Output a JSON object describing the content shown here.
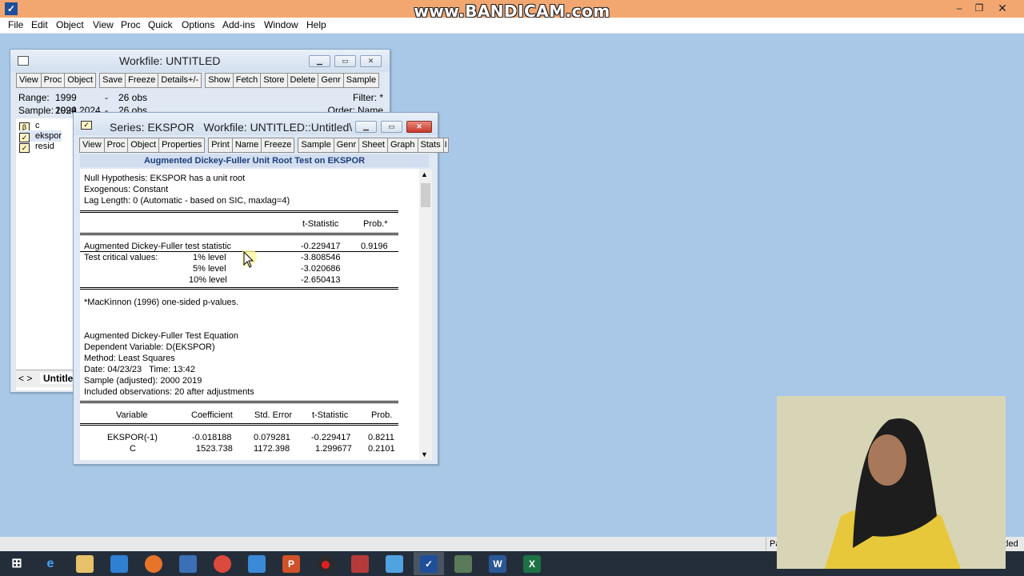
{
  "watermark": "www.BANDICAM.com",
  "menu": [
    "File",
    "Edit",
    "Object",
    "View",
    "Proc",
    "Quick",
    "Options",
    "Add-ins",
    "Window",
    "Help"
  ],
  "workfile": {
    "title": "Workfile: UNTITLED",
    "toolbar": [
      "View",
      "Proc",
      "Object",
      "Save",
      "Freeze",
      "Details+/-",
      "Show",
      "Fetch",
      "Store",
      "Delete",
      "Genr",
      "Sample"
    ],
    "range_label": "Range:",
    "range_value": "1999 2024",
    "range_sep": "--",
    "range_obs": "26 obs",
    "sample_label": "Sample:",
    "sample_value": "1999 2024",
    "sample_sep": "--",
    "sample_obs": "26 obs",
    "filter": "Filter: *",
    "order": "Order: Name",
    "objects": [
      {
        "icon": "β",
        "name": "c"
      },
      {
        "icon": "✓",
        "name": "ekspor"
      },
      {
        "icon": "✓",
        "name": "resid"
      }
    ],
    "tab": "Untitled",
    "tab_nav": "< >"
  },
  "series": {
    "title": "Series: EKSPOR   Workfile: UNTITLED::Untitled\\",
    "toolbar": [
      "View",
      "Proc",
      "Object",
      "Properties",
      "Print",
      "Name",
      "Freeze",
      "Sample",
      "Genr",
      "Sheet",
      "Graph",
      "Stats",
      "I"
    ],
    "subtitle": "Augmented Dickey-Fuller Unit Root Test on EKSPOR",
    "null_hypothesis": "Null Hypothesis: EKSPOR has a unit root",
    "exogenous": "Exogenous: Constant",
    "lag_length": "Lag Length: 0 (Automatic - based on SIC, maxlag=4)",
    "col_tstat": "t-Statistic",
    "col_prob": "Prob.*",
    "adf_label": "Augmented Dickey-Fuller test statistic",
    "adf_tstat": "-0.229417",
    "adf_prob": "0.9196",
    "crit_label": "Test critical values:",
    "crit": [
      {
        "level": "1% level",
        "value": "-3.808546"
      },
      {
        "level": "5% level",
        "value": "-3.020686"
      },
      {
        "level": "10% level",
        "value": "-2.650413"
      }
    ],
    "footnote": "*MacKinnon (1996) one-sided p-values.",
    "eq_title": "Augmented Dickey-Fuller Test Equation",
    "dep_var": "Dependent Variable: D(EKSPOR)",
    "method": "Method: Least Squares",
    "date": "Date: 04/23/23   Time: 13:42",
    "sample_adj": "Sample (adjusted): 2000 2019",
    "included": "Included observations: 20 after adjustments",
    "reg_headers": [
      "Variable",
      "Coefficient",
      "Std. Error",
      "t-Statistic",
      "Prob."
    ],
    "reg_rows": [
      [
        "EKSPOR(-1)",
        "-0.018188",
        "0.079281",
        "-0.229417",
        "0.8211"
      ],
      [
        "C",
        "1523.738",
        "1172.398",
        "1.299677",
        "0.2101"
      ]
    ]
  },
  "statusbar": {
    "path": "Pa",
    "wf": "tled"
  },
  "taskbar_icons": [
    "windows-start",
    "ie",
    "explorer",
    "app1",
    "firefox",
    "app2",
    "chrome",
    "app3",
    "powerpoint",
    "bandicam",
    "app4",
    "app5",
    "eviews",
    "app6",
    "word",
    "excel"
  ]
}
